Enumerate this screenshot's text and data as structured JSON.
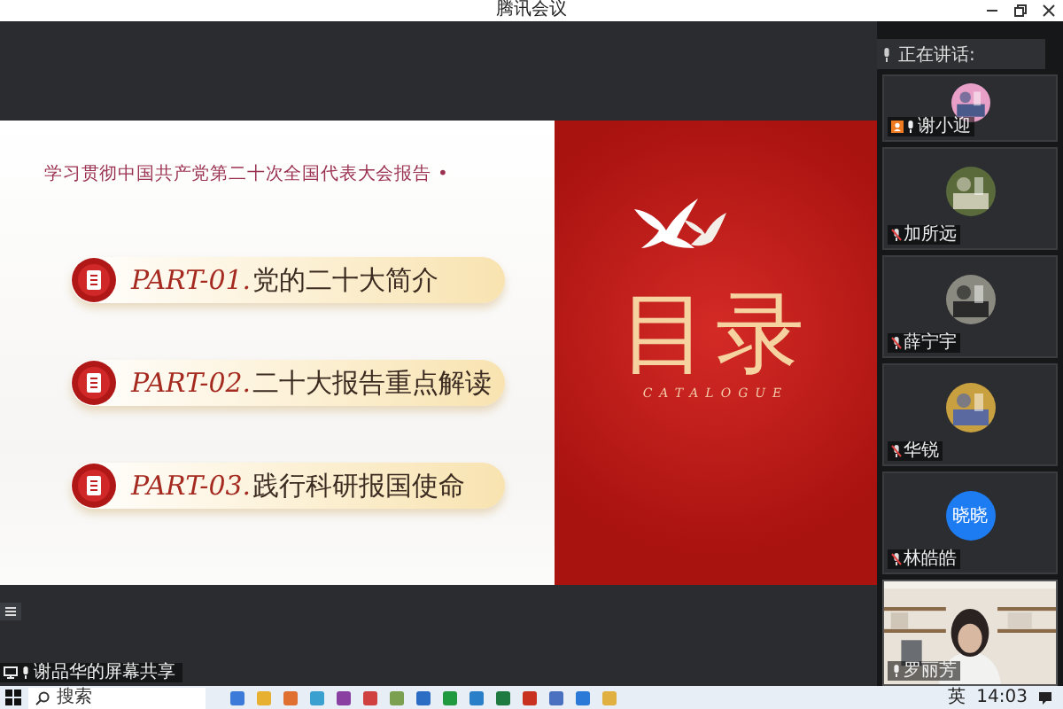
{
  "window": {
    "title": "腾讯会议"
  },
  "slide": {
    "heading": "学习贯彻中国共产党第二十次全国代表大会报告 •",
    "parts": [
      {
        "number": "PART-01.",
        "title": "党的二十大简介"
      },
      {
        "number": "PART-02.",
        "title": "二十大报告重点解读"
      },
      {
        "number": "PART-03.",
        "title": "践行科研报国使命"
      }
    ],
    "title": "目录",
    "subtitle": "CATALOGUE"
  },
  "share_label": "谢品华的屏幕共享",
  "speaking": {
    "label": "正在讲话:"
  },
  "participants": [
    {
      "name": "谢小迎",
      "host": true,
      "muted": false
    },
    {
      "name": "加所远",
      "host": false,
      "muted": true
    },
    {
      "name": "薛宁宇",
      "host": false,
      "muted": true
    },
    {
      "name": "华锐",
      "host": false,
      "muted": true
    },
    {
      "name": "林皓皓",
      "kind": "initials",
      "avatar_text": "晓晓",
      "host": false,
      "muted": true
    },
    {
      "name": "罗丽芳",
      "kind": "video",
      "host": false,
      "muted": false
    }
  ],
  "taskbar": {
    "search_placeholder": "搜索",
    "ime": "英",
    "time": "14:03"
  }
}
